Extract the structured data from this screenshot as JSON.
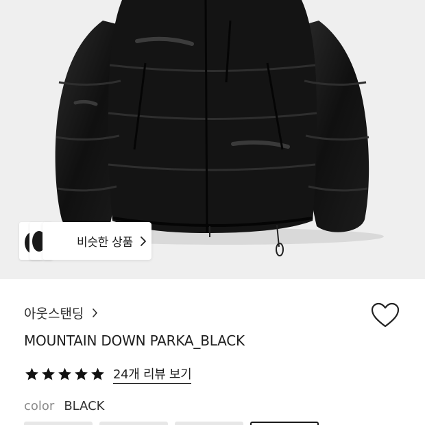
{
  "product_image": {
    "alt": "black puffer down jacket"
  },
  "similar_products": {
    "label": "비슷한 상품"
  },
  "brand": {
    "name": "아웃스탠딩"
  },
  "product": {
    "name": "MOUNTAIN DOWN PARKA_BLACK"
  },
  "rating": {
    "stars": 5,
    "max_stars": 5,
    "review_link_label": "24개 리뷰 보기"
  },
  "color_option": {
    "label": "color",
    "value": "BLACK"
  },
  "swatches": {
    "count": 4,
    "selected_index": 3
  },
  "colors": {
    "background": "#efefef",
    "text_primary": "#1f1f1f",
    "text_muted": "#8a8a8a",
    "star": "#111111"
  }
}
